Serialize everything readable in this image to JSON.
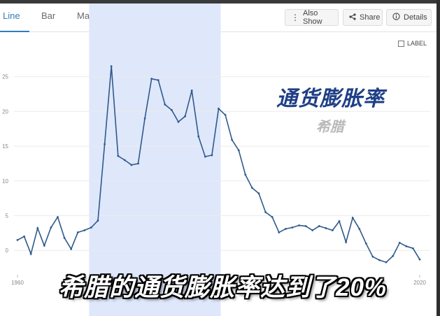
{
  "tabs": [
    {
      "label": "Line"
    },
    {
      "label": "Bar"
    },
    {
      "label": "Map"
    }
  ],
  "buttons": {
    "also_show": "Also Show",
    "share": "Share",
    "details": "Details"
  },
  "label_toggle": "LABEL",
  "overlay": {
    "title": "通货膨胀率",
    "subtitle": "希腊"
  },
  "caption": "希腊的通货膨胀率达到了20%",
  "colors": {
    "accent": "#2f7cc0",
    "line": "#2f5a8c",
    "highlight": "#dfe7fb"
  },
  "icons": [
    "plus-icon",
    "share-icon",
    "info-icon",
    "checkbox-icon"
  ],
  "chart_data": {
    "type": "line",
    "x": [
      1960,
      1961,
      1962,
      1963,
      1964,
      1965,
      1966,
      1967,
      1968,
      1969,
      1970,
      1971,
      1972,
      1973,
      1974,
      1975,
      1976,
      1977,
      1978,
      1979,
      1980,
      1981,
      1982,
      1983,
      1984,
      1985,
      1986,
      1987,
      1988,
      1989,
      1990,
      1991,
      1992,
      1993,
      1994,
      1995,
      1996,
      1997,
      1998,
      1999,
      2000,
      2001,
      2002,
      2003,
      2004,
      2005,
      2006,
      2007,
      2008,
      2009,
      2010,
      2011,
      2012,
      2013,
      2014,
      2015,
      2016,
      2017,
      2018,
      2019,
      2020
    ],
    "values": [
      1.5,
      2.0,
      -0.5,
      3.2,
      0.7,
      3.3,
      4.8,
      1.8,
      0.2,
      2.6,
      2.9,
      3.3,
      4.3,
      15.3,
      26.5,
      13.6,
      13.0,
      12.3,
      12.5,
      19.0,
      24.7,
      24.5,
      21.0,
      20.2,
      18.5,
      19.3,
      23.0,
      16.4,
      13.5,
      13.7,
      20.4,
      19.5,
      15.9,
      14.4,
      10.9,
      9.0,
      8.2,
      5.5,
      4.8,
      2.6,
      3.1,
      3.3,
      3.6,
      3.5,
      2.9,
      3.5,
      3.2,
      2.9,
      4.2,
      1.2,
      4.7,
      3.1,
      1.0,
      -0.9,
      -1.4,
      -1.7,
      -0.8,
      1.1,
      0.6,
      0.3,
      -1.3
    ],
    "tick_labels_y": [
      "0",
      "5",
      "10",
      "15",
      "20",
      "25"
    ],
    "tick_labels_x": [
      "1960",
      "2020"
    ],
    "y_tick_values": [
      0,
      5,
      10,
      15,
      20,
      25
    ],
    "ylim": [
      -3.5,
      30
    ],
    "highlight_range": [
      1971,
      1990
    ],
    "grid": true
  }
}
